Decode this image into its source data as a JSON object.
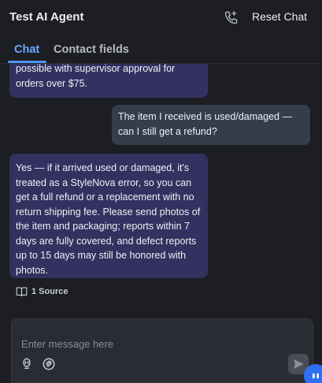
{
  "header": {
    "title": "Test AI Agent",
    "reset_label": "Reset Chat"
  },
  "tabs": [
    {
      "label": "Chat",
      "active": true
    },
    {
      "label": "Contact fields",
      "active": false
    }
  ],
  "messages": [
    {
      "role": "bot",
      "text": "possible with supervisor approval for orders over $75."
    },
    {
      "role": "user",
      "text": "The item I received is used/damaged — can I still get a refund?"
    },
    {
      "role": "bot",
      "text": "Yes — if it arrived used or damaged, it's treated as a StyleNova error, so you can get a full refund or a replacement with no return shipping fee. Please send photos of the item and packaging; reports within 7 days are fully covered, and defect reports up to 15 days may still be honored with photos."
    }
  ],
  "source_label": "1 Source",
  "composer": {
    "placeholder": "Enter message here"
  },
  "colors": {
    "accent": "#4f93f7",
    "bot_bubble": "#33315f",
    "user_bubble": "#343d4c",
    "background": "#1c1e23"
  }
}
